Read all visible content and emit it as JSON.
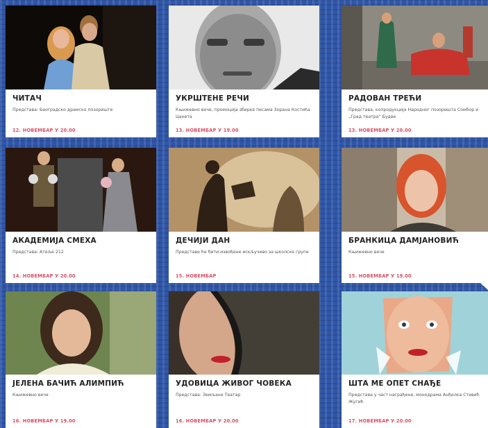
{
  "cards": [
    {
      "title": "ЧИТАЧ",
      "desc": "Представа: Београдско драмско позориште",
      "date": "12. НОВЕМБАР У 20.00"
    },
    {
      "title": "УКРШТЕНЕ РЕЧИ",
      "desc": "Књижевно вече, промоција збирке песама Зорана Костића Цанета",
      "date": "13. НОВЕМБАР У 19.00"
    },
    {
      "title": "РАДОВАН ТРЕЋИ",
      "desc": "Представа, копродукција Народног позоришта Сомбор и „Град театра“ Будве",
      "date": "13. НОВЕМБАР У 20.00"
    },
    {
      "title": "АКАДЕМИЈА СМЕХА",
      "desc": "Представа: Атеље 212",
      "date": "14. НОВЕМБАР У 20.00"
    },
    {
      "title": "ДЕЧИЈИ ДАН",
      "desc": "Представе ће бити извођене искључиво за школске групе",
      "date": "15. НОВЕМБАР"
    },
    {
      "title": "БРАНКИЦА ДАМЈАНОВИЋ",
      "desc": "Књижевно вече",
      "date": "15. НОВЕМБАР У 19.00"
    },
    {
      "title": "ЈЕЛЕНА БАЧИЋ АЛИМПИЋ",
      "desc": "Књижевно вече",
      "date": "16. НОВЕМБАР У 19.00"
    },
    {
      "title": "УДОВИЦА ЖИВОГ ЧОВЕКА",
      "desc": "Представа: Земљане Театар",
      "date": "16. НОВЕМБАР У 20.00"
    },
    {
      "title": "ШТА МЕ ОПЕТ СНАЂЕ",
      "desc": "Представа у част награђене, монодрама Анђелка Стевић Жугић",
      "date": "17. НОВЕМБАР У 20.00"
    }
  ]
}
